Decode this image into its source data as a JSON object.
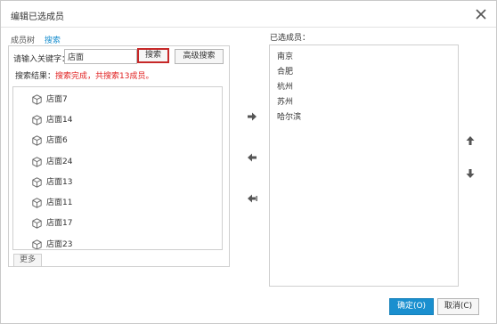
{
  "dialog": {
    "title": "编辑已选成员"
  },
  "tabs": [
    {
      "label": "成员树"
    },
    {
      "label": "搜索",
      "active": true
    }
  ],
  "search": {
    "label": "请输入关键字：",
    "value": "店面",
    "search_button": "搜索",
    "advanced_button": "高级搜索"
  },
  "result": {
    "prefix": "搜索结果：",
    "message": "搜索完成，共搜索13成员。"
  },
  "results_list": [
    {
      "label": "店面7"
    },
    {
      "label": "店面14"
    },
    {
      "label": "店面6"
    },
    {
      "label": "店面24"
    },
    {
      "label": "店面13"
    },
    {
      "label": "店面11"
    },
    {
      "label": "店面17"
    },
    {
      "label": "店面23"
    }
  ],
  "more_button": "更多",
  "selected": {
    "label": "已选成员：",
    "items": [
      "南京",
      "合肥",
      "杭州",
      "苏州",
      "哈尔滨"
    ]
  },
  "footer": {
    "ok": "确定(O)",
    "cancel": "取消(C)"
  },
  "colors": {
    "accent": "#1a8fcf",
    "error": "#e02020",
    "highlight_border": "#c62828"
  },
  "icons": [
    "close-icon",
    "cube-icon",
    "arrow-right-icon",
    "arrow-left-icon",
    "double-arrow-left-icon",
    "arrow-up-icon",
    "arrow-down-icon"
  ]
}
